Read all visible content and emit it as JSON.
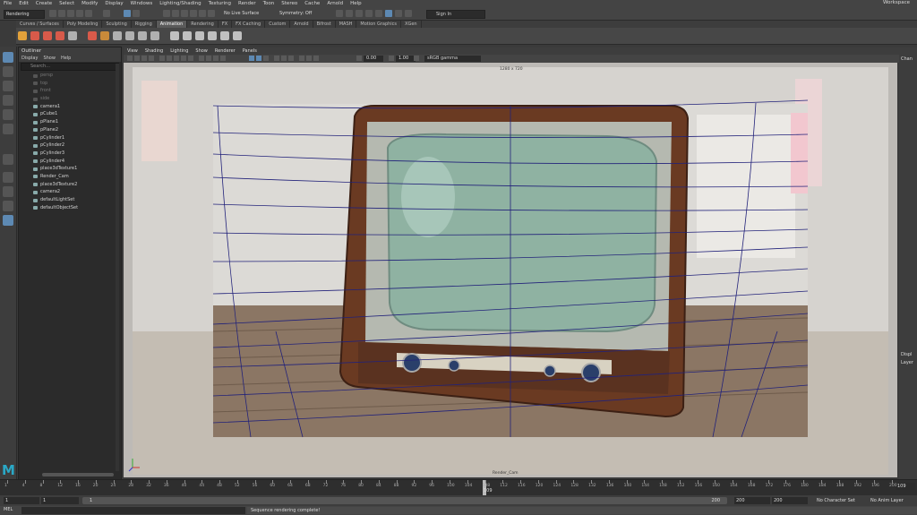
{
  "menubar": {
    "items": [
      "File",
      "Edit",
      "Create",
      "Select",
      "Modify",
      "Display",
      "Windows",
      "Lighting/Shading",
      "Texturing",
      "Render",
      "Toon",
      "Stereo",
      "Cache",
      "Arnold",
      "Help"
    ],
    "workspace": "Workspace"
  },
  "statusline": {
    "mode": "Rendering",
    "live_surface": "No Live Surface",
    "symmetry": "Symmetry: Off",
    "sign_in": "Sign In"
  },
  "shelf_tabs": [
    "Curves / Surfaces",
    "Poly Modeling",
    "Sculpting",
    "Rigging",
    "Animation",
    "Rendering",
    "FX",
    "FX Caching",
    "Custom",
    "Arnold",
    "Bifrost",
    "MASH",
    "Motion Graphics",
    "XGen"
  ],
  "shelf_active": "Animation",
  "outliner": {
    "title": "Outliner",
    "menu": [
      "Display",
      "Show",
      "Help"
    ],
    "search_placeholder": "Search...",
    "items": [
      {
        "label": "persp",
        "dim": true
      },
      {
        "label": "top",
        "dim": true
      },
      {
        "label": "front",
        "dim": true
      },
      {
        "label": "side",
        "dim": true
      },
      {
        "label": "camera1",
        "dim": false
      },
      {
        "label": "pCube1",
        "dim": false
      },
      {
        "label": "pPlane1",
        "dim": false
      },
      {
        "label": "pPlane2",
        "dim": false
      },
      {
        "label": "pCylinder1",
        "dim": false
      },
      {
        "label": "pCylinder2",
        "dim": false
      },
      {
        "label": "pCylinder3",
        "dim": false
      },
      {
        "label": "pCylinder4",
        "dim": false
      },
      {
        "label": "place3dTexture1",
        "dim": false
      },
      {
        "label": "Render_Cam",
        "dim": false
      },
      {
        "label": "place3dTexture2",
        "dim": false
      },
      {
        "label": "camera2",
        "dim": false
      },
      {
        "label": "defaultLightSet",
        "dim": false
      },
      {
        "label": "defaultObjectSet",
        "dim": false
      }
    ]
  },
  "viewport": {
    "menu": [
      "View",
      "Shading",
      "Lighting",
      "Show",
      "Renderer",
      "Panels"
    ],
    "value_a": "0.00",
    "value_b": "1.00",
    "gamma": "sRGB gamma",
    "resolution": "1280 x 720",
    "camera_label": "Render_Cam"
  },
  "right_panel": {
    "top_label": "Chan",
    "mid_label": "Displ",
    "mid_label2": "Layer"
  },
  "timeline": {
    "ticks": [
      "1",
      "4",
      "8",
      "12",
      "16",
      "20",
      "24",
      "28",
      "32",
      "36",
      "40",
      "44",
      "48",
      "52",
      "56",
      "60",
      "64",
      "68",
      "72",
      "76",
      "80",
      "84",
      "88",
      "92",
      "96",
      "100",
      "104",
      "108",
      "112",
      "116",
      "120",
      "124",
      "128",
      "132",
      "136",
      "140",
      "144",
      "148",
      "152",
      "156",
      "160",
      "164",
      "168",
      "172",
      "176",
      "180",
      "184",
      "188",
      "192",
      "196",
      "200"
    ],
    "current_frame": "109",
    "current_frame_field": "109"
  },
  "range": {
    "start": "1",
    "start2": "1",
    "slider_start": "1",
    "slider_end": "200",
    "end": "200",
    "end2": "200",
    "character_set": "No Character Set",
    "anim_layer": "No Anim Layer"
  },
  "cmdline": {
    "lang": "MEL",
    "result": "Sequence rendering complete!"
  },
  "colors": {
    "accent_blue": "#5d89b3",
    "maya_logo": "#2aa8c6",
    "panel_dark": "#2b2b2b",
    "grid_line": "#22227a"
  }
}
